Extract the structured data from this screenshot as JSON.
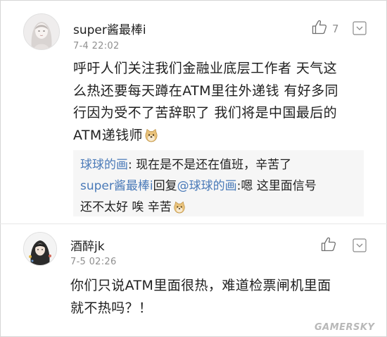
{
  "comments": [
    {
      "username": "super酱最棒i",
      "timestamp": "7-4 22:02",
      "like_count": "7",
      "body": "呼吁人们关注我们金融业底层工作者 天气这\n么热还要每天蹲在ATM里往外递钱 有好多同\n行因为受不了苦辞职了 我们将是中国最后的\nATM递钱师",
      "replies": [
        {
          "author": "球球的画",
          "separator": ": ",
          "text": "现在是不是还在值班，辛苦了"
        },
        {
          "author": "super酱最棒i",
          "verb": "回复",
          "mention": "@球球的画",
          "separator": ":",
          "text_line1": "嗯 这里面信号",
          "text_line2": "还不太好 唉 辛苦"
        }
      ]
    },
    {
      "username": "酒醉jk",
      "timestamp": "7-5 02:26",
      "like_count": "",
      "body": "你们只说ATM里面很热，难道检票闸机里面\n就不热吗？！"
    }
  ],
  "icons": {
    "like": "thumbs-up-icon",
    "more": "chevron-down-icon",
    "emoji": "doge-emoji-icon"
  },
  "colors": {
    "mention": "#4a7ab8",
    "muted": "#8f8f8f",
    "reply_bg": "#f6f6f6"
  },
  "watermark": "GAMERSKY"
}
